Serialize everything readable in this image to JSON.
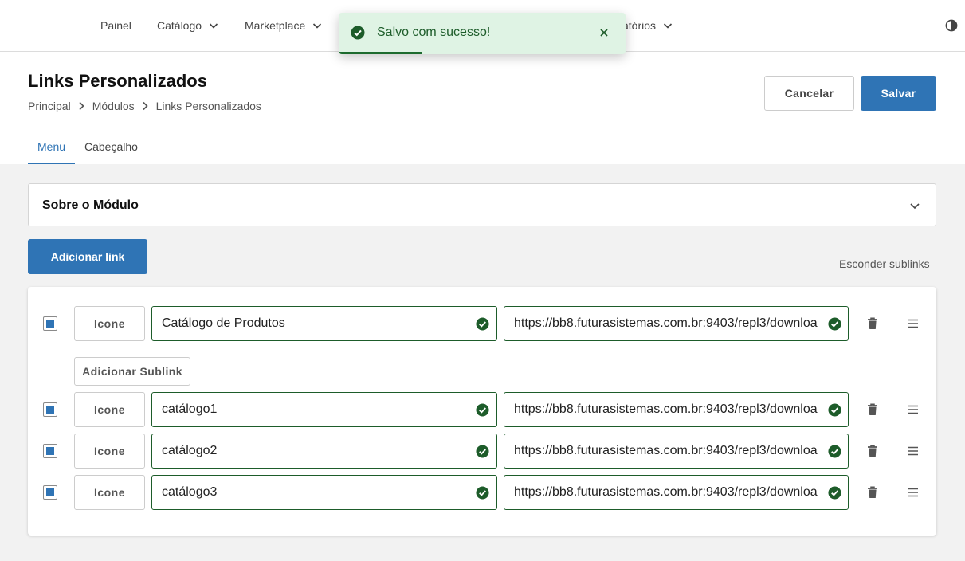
{
  "nav": {
    "items": [
      {
        "label": "Painel",
        "has_dropdown": false
      },
      {
        "label": "Catálogo",
        "has_dropdown": true
      },
      {
        "label": "Marketplace",
        "has_dropdown": true
      },
      {
        "label": "atórios",
        "has_dropdown": true
      }
    ],
    "theme_icon": "contrast-icon"
  },
  "toast": {
    "message": "Salvo com sucesso!",
    "icon": "check-circle-icon",
    "close_icon": "close-icon",
    "progress": 0.29,
    "color": "#1d5c2a",
    "background": "#dff3e4"
  },
  "header": {
    "title": "Links Personalizados",
    "breadcrumb": [
      "Principal",
      "Módulos",
      "Links Personalizados"
    ],
    "cancel_label": "Cancelar",
    "save_label": "Salvar"
  },
  "tabs": [
    {
      "label": "Menu",
      "active": true
    },
    {
      "label": "Cabeçalho",
      "active": false
    }
  ],
  "accordion": {
    "title": "Sobre o Módulo",
    "expanded": false
  },
  "actions": {
    "add_link_label": "Adicionar link",
    "toggle_sublinks_label": "Esconder sublinks",
    "add_sublink_label": "Adicionar Sublink"
  },
  "links": [
    {
      "checked": true,
      "icon_label": "Icone",
      "name": "Catálogo de Produtos",
      "url": "https://bb8.futurasistemas.com.br:9403/repl3/downloa",
      "valid": true
    },
    {
      "checked": true,
      "icon_label": "Icone",
      "name": "catálogo1",
      "url": "https://bb8.futurasistemas.com.br:9403/repl3/downloa",
      "valid": true
    },
    {
      "checked": true,
      "icon_label": "Icone",
      "name": "catálogo2",
      "url": "https://bb8.futurasistemas.com.br:9403/repl3/downloa",
      "valid": true
    },
    {
      "checked": true,
      "icon_label": "Icone",
      "name": "catálogo3",
      "url": "https://bb8.futurasistemas.com.br:9403/repl3/downloa",
      "valid": true
    }
  ],
  "colors": {
    "primary": "#2f74b5",
    "success": "#1d5c2a",
    "background": "#f2f2f2"
  }
}
